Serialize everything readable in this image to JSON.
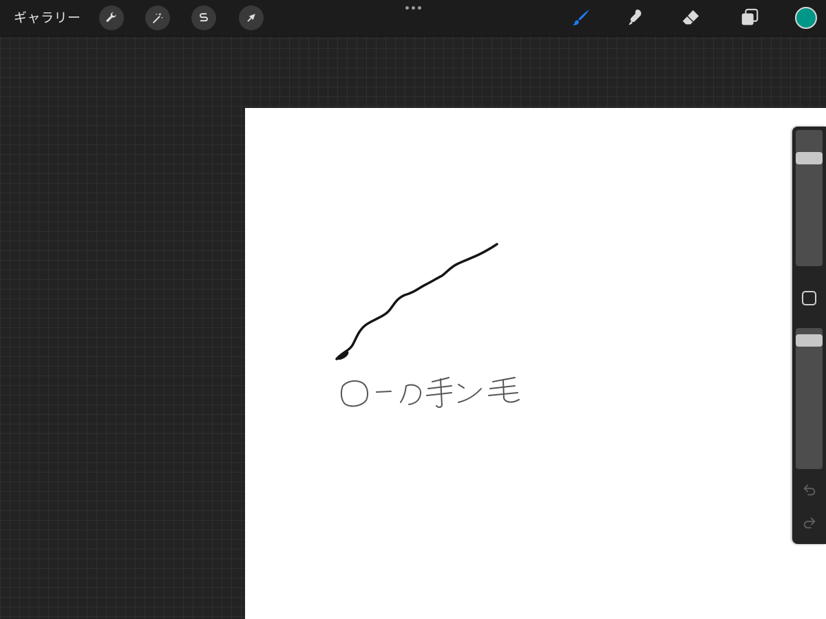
{
  "toolbar": {
    "gallery_label": "ギャラリー",
    "left_tools": [
      {
        "icon": "wrench-icon",
        "name": "actions"
      },
      {
        "icon": "magic-wand-icon",
        "name": "adjustments"
      },
      {
        "icon": "selection-s-icon",
        "name": "selection"
      },
      {
        "icon": "arrow-cursor-icon",
        "name": "transform"
      }
    ],
    "more_icon": "more-dots-icon",
    "right_tools": [
      {
        "icon": "brush-icon",
        "name": "paint",
        "active": true
      },
      {
        "icon": "smudge-icon",
        "name": "smudge",
        "active": false
      },
      {
        "icon": "eraser-icon",
        "name": "erase",
        "active": false
      },
      {
        "icon": "layers-icon",
        "name": "layers",
        "active": false
      }
    ],
    "current_color": "#009688"
  },
  "canvas": {
    "background": "#ffffff",
    "handwritten_text": "ローの手ン毛"
  },
  "sidebar": {
    "brush_size_level": 0.82,
    "opacity_level": 0.95,
    "modify_icon": "modify-square-icon",
    "undo_icon": "undo-icon",
    "redo_icon": "redo-icon"
  },
  "colors": {
    "accent_active": "#1e7bf0",
    "tool_inactive": "#d9d9d9",
    "toolbar_bg": "#1c1c1c",
    "grid_bg": "#232323"
  }
}
